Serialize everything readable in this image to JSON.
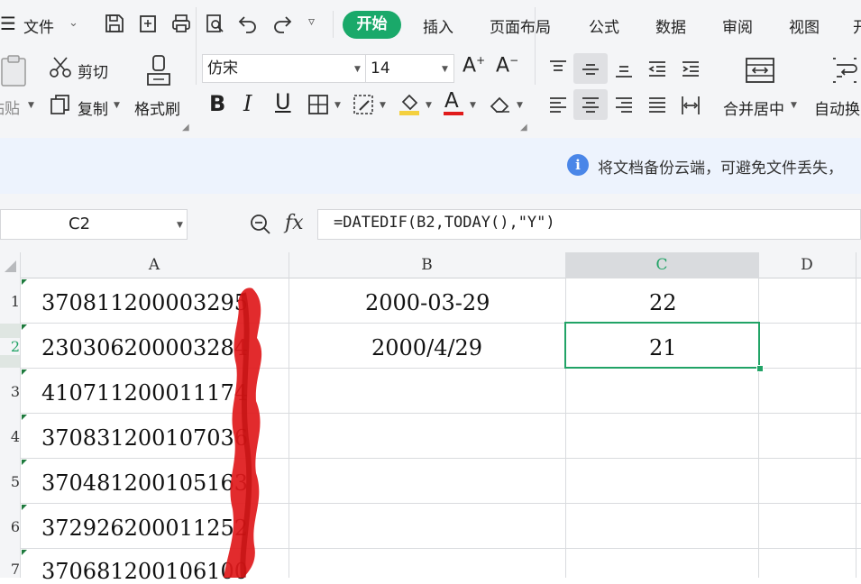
{
  "menubar": {
    "file_label": "文件",
    "tabs": [
      "开始",
      "插入",
      "页面布局",
      "公式",
      "数据",
      "审阅",
      "视图",
      "开"
    ]
  },
  "ribbon": {
    "paste_label": "粘贴",
    "cut_label": "剪切",
    "copy_label": "复制",
    "format_painter_label": "格式刷",
    "font_name": "仿宋",
    "font_size": "14",
    "merge_center_label": "合并居中",
    "auto_wrap_label": "自动换"
  },
  "notice": {
    "text": "将文档备份云端，可避免文件丢失，"
  },
  "formula_bar": {
    "name_box": "C2",
    "fx_label": "fx",
    "formula": "=DATEDIF(B2,TODAY(),\"Y\")"
  },
  "sheet": {
    "columns": [
      "A",
      "B",
      "C",
      "D"
    ],
    "selected_cell": "C2",
    "rows": [
      {
        "num": "1",
        "a": "370811200003295",
        "b": "2000-03-29",
        "c": "22"
      },
      {
        "num": "2",
        "a": "230306200003284",
        "b": "2000/4/29",
        "c": "21"
      },
      {
        "num": "3",
        "a": "410711200011174",
        "b": "",
        "c": ""
      },
      {
        "num": "4",
        "a": "370831200107036",
        "b": "",
        "c": ""
      },
      {
        "num": "5",
        "a": "370481200105163",
        "b": "",
        "c": ""
      },
      {
        "num": "6",
        "a": "372926200011252",
        "b": "",
        "c": ""
      },
      {
        "num": "7",
        "a": "370681200106100",
        "b": "",
        "c": ""
      }
    ]
  },
  "colors": {
    "accent_green": "#1aa96a",
    "selection_green": "#21a366",
    "info_blue": "#4a86e8",
    "redaction_red": "#e0191b"
  }
}
